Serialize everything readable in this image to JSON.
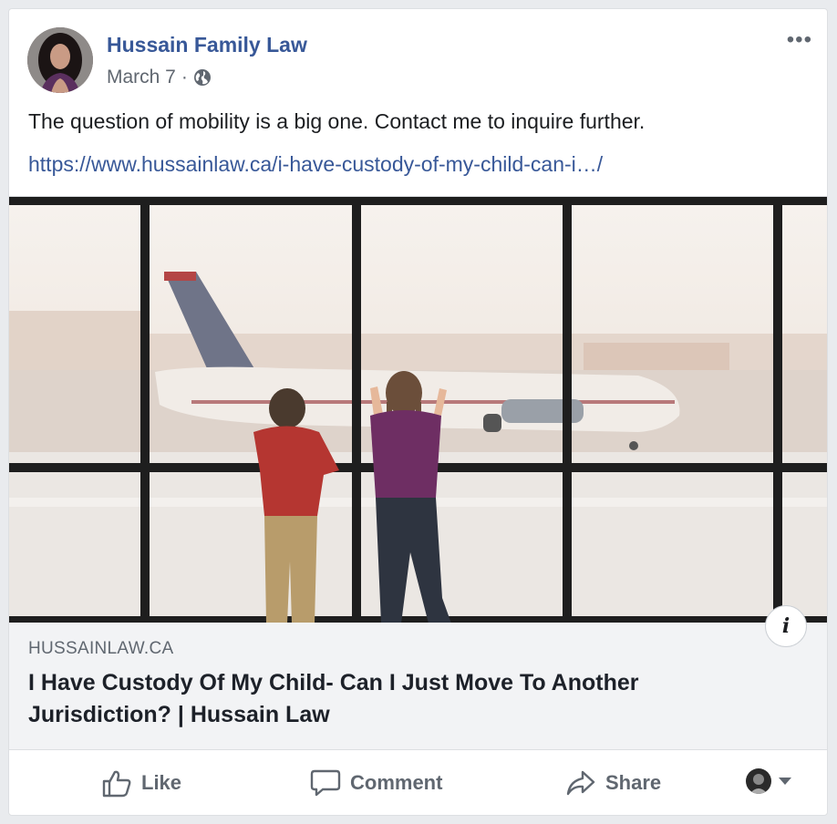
{
  "post": {
    "page_name": "Hussain Family Law",
    "date": "March 7",
    "separator": "·",
    "privacy_icon": "globe-icon",
    "more_icon": "more-options-icon",
    "more_label": "•••",
    "text": "The question of mobility is a big one. Contact me to inquire further.",
    "link_url": "https://www.hussainlaw.ca/i-have-custody-of-my-child-can-i…/"
  },
  "link_preview": {
    "domain": "HUSSAINLAW.CA",
    "title": "I Have Custody Of My Child- Can I Just Move To Another Jurisdiction? | Hussain Law",
    "info_label": "i"
  },
  "actions": {
    "like": "Like",
    "comment": "Comment",
    "share": "Share"
  },
  "colors": {
    "link_blue": "#385898",
    "secondary_text": "#606770",
    "background": "#e9ebee"
  }
}
